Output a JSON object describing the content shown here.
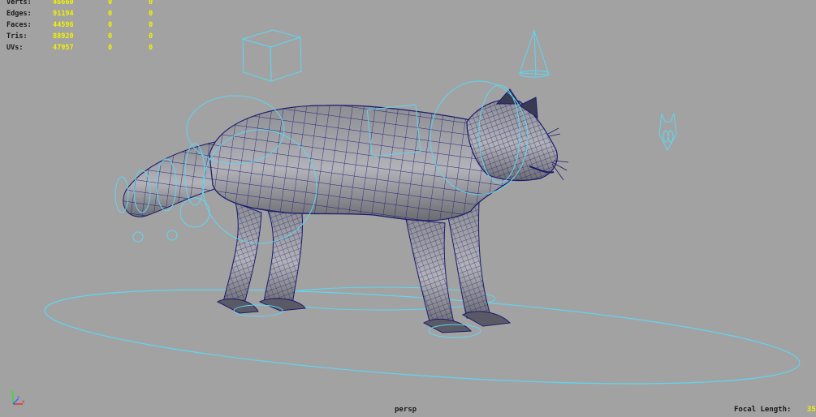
{
  "viewport": {
    "camera_name": "persp",
    "focal_length_label": "Focal Length:",
    "focal_length_value": "35",
    "background_color": "#a2a2a2",
    "wireframe_color": "#1a1a6e",
    "rig_color": "#5fd6f2",
    "hud_value_color": "#f2f200"
  },
  "stats": [
    {
      "label": "Verts:",
      "value": "46660",
      "c1": "0",
      "c2": "0"
    },
    {
      "label": "Edges:",
      "value": "91194",
      "c1": "0",
      "c2": "0"
    },
    {
      "label": "Faces:",
      "value": "44596",
      "c1": "0",
      "c2": "0"
    },
    {
      "label": "Tris:",
      "value": "88920",
      "c1": "0",
      "c2": "0"
    },
    {
      "label": "UVs:",
      "value": "47957",
      "c1": "0",
      "c2": "0"
    }
  ],
  "axis_labels": {
    "x": "x",
    "y": "y",
    "z": "z"
  }
}
